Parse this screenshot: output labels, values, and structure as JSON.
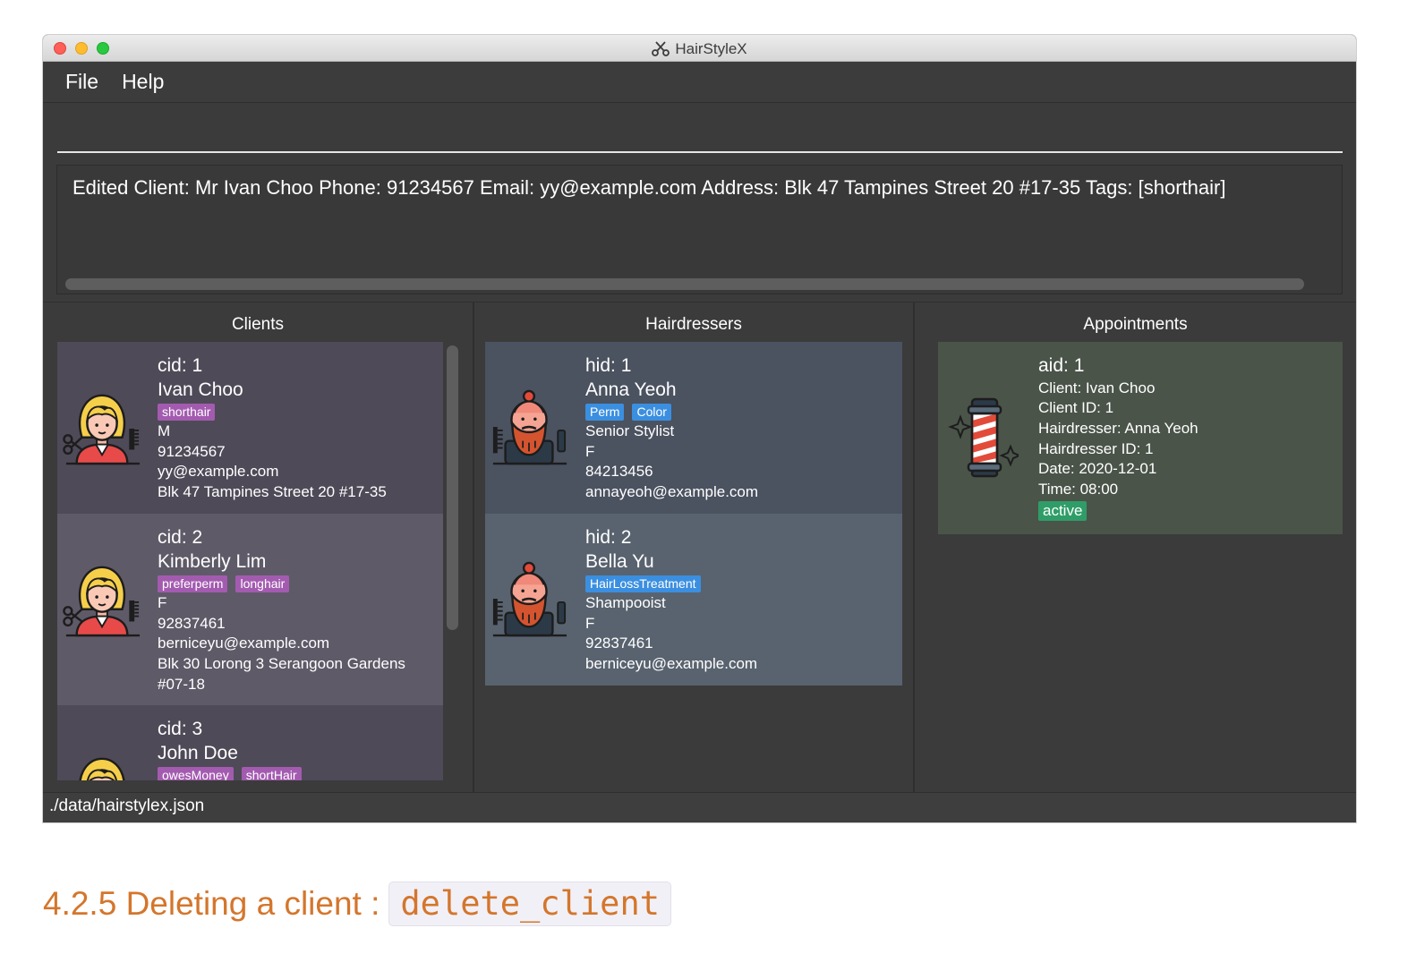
{
  "window": {
    "title": "HairStyleX",
    "menu": [
      "File",
      "Help"
    ]
  },
  "command_box": {
    "value": ""
  },
  "result_display": {
    "text": "Edited Client: Mr Ivan Choo Phone: 91234567 Email: yy@example.com Address: Blk 47 Tampines Street 20 #17-35 Tags: [shorthair]"
  },
  "panels": {
    "clients": {
      "title": "Clients",
      "items": [
        {
          "id": "cid: 1",
          "name": "Ivan Choo",
          "tags": [
            "shorthair"
          ],
          "gender": "M",
          "phone": "91234567",
          "email": "yy@example.com",
          "address": "Blk 47 Tampines Street 20 #17-35",
          "address2": ""
        },
        {
          "id": "cid: 2",
          "name": "Kimberly Lim",
          "tags": [
            "preferperm",
            "longhair"
          ],
          "gender": "F",
          "phone": "92837461",
          "email": "berniceyu@example.com",
          "address": "Blk 30 Lorong 3 Serangoon Gardens",
          "address2": "#07-18"
        },
        {
          "id": "cid: 3",
          "name": "John Doe",
          "tags": [
            "owesMoney",
            "shortHair"
          ]
        }
      ]
    },
    "hairdressers": {
      "title": "Hairdressers",
      "items": [
        {
          "id": "hid: 1",
          "name": "Anna Yeoh",
          "tags": [
            "Perm",
            "Color"
          ],
          "title": "Senior Stylist",
          "gender": "F",
          "phone": "84213456",
          "email": "annayeoh@example.com"
        },
        {
          "id": "hid: 2",
          "name": "Bella Yu",
          "tags": [
            "HairLossTreatment"
          ],
          "title": "Shampooist",
          "gender": "F",
          "phone": "92837461",
          "email": "berniceyu@example.com"
        }
      ]
    },
    "appointments": {
      "title": "Appointments",
      "items": [
        {
          "id": "aid: 1",
          "client": "Client: Ivan Choo",
          "client_id": "Client ID: 1",
          "hairdresser": "Hairdresser: Anna Yeoh",
          "hairdresser_id": "Hairdresser ID: 1",
          "date": "Date: 2020-12-01",
          "time": "Time: 08:00",
          "status": "active"
        }
      ]
    }
  },
  "status_bar": {
    "path": "./data/hairstylex.json"
  },
  "doc_heading": {
    "text": "4.2.5 Deleting a client :",
    "code": "delete_client"
  },
  "colors": {
    "client_card_a": "#4f4a58",
    "client_card_b": "#5f5a68",
    "hairdresser_card_a": "#4b5260",
    "hairdresser_card_b": "#59636f",
    "appointment_card": "#4a5449",
    "tag_purple": "#a35bb0",
    "tag_blue": "#3b8fe0",
    "tag_green": "#2f9d68",
    "heading_orange": "#d4762c"
  }
}
